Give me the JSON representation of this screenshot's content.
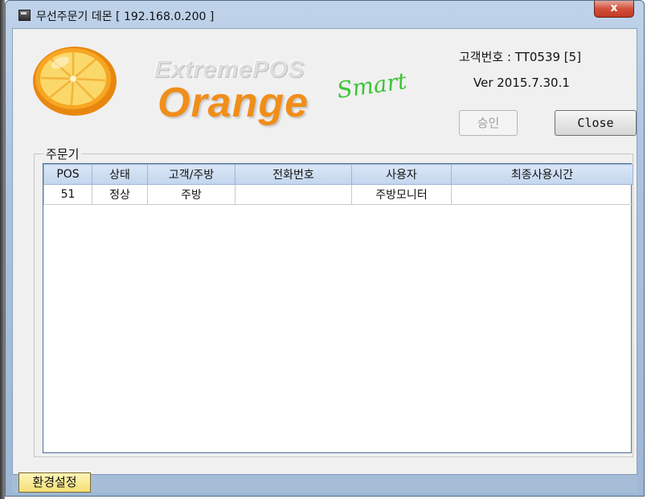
{
  "window": {
    "title": "무선주문기 데몬 [ 192.168.0.200 ]",
    "close_glyph": "x"
  },
  "header": {
    "brand_top": "ExtremePOS",
    "brand_main": "Orange",
    "brand_script": "Smart",
    "customer_no": "고객번호 : TT0539 [5]",
    "version": "Ver 2015.7.30.1",
    "approve_label": "승인",
    "close_label": "Close"
  },
  "group": {
    "title": "주문기"
  },
  "table": {
    "columns": [
      "POS",
      "상태",
      "고객/주방",
      "전화번호",
      "사용자",
      "최종사용시간"
    ],
    "rows": [
      [
        "51",
        "정상",
        "주방",
        "",
        "주방모니터",
        ""
      ]
    ]
  },
  "status": {
    "settings_tab": "환경설정"
  },
  "colors": {
    "brand_orange": "#f08e1a",
    "brand_green": "#3bc534",
    "close_red": "#c13a23",
    "tab_yellow": "#f5df76"
  }
}
